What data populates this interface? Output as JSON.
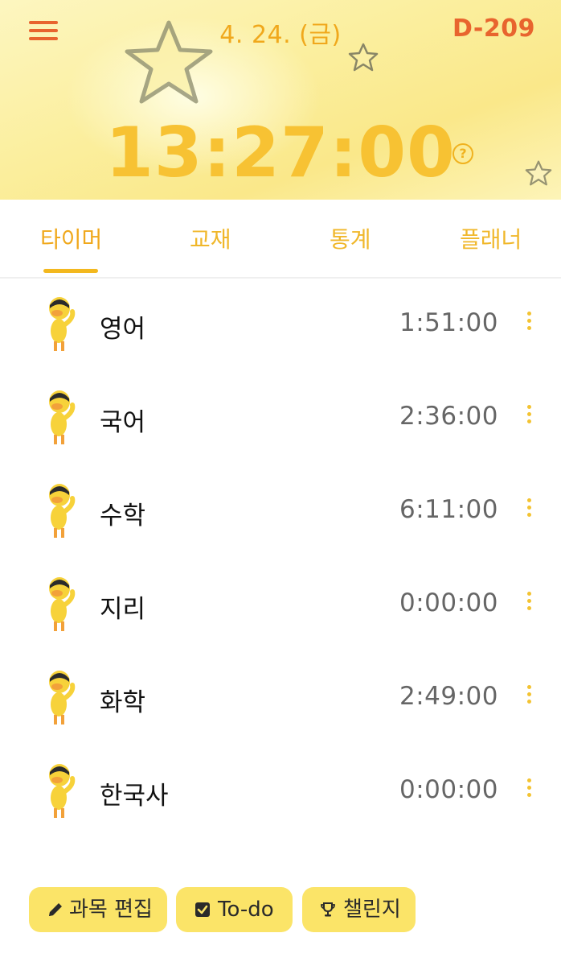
{
  "header": {
    "date": "4. 24. (금)",
    "dday": "D-209",
    "total_time": "13:27:00",
    "help_glyph": "?",
    "accent_color": "#f7c233",
    "dday_color": "#e8642e"
  },
  "tabs": [
    {
      "label": "타이머",
      "selected": true
    },
    {
      "label": "교재",
      "selected": false
    },
    {
      "label": "통계",
      "selected": false
    },
    {
      "label": "플래너",
      "selected": false
    }
  ],
  "subjects": [
    {
      "name": "영어",
      "time": "1:51:00",
      "icon": "duck-avatar-icon"
    },
    {
      "name": "국어",
      "time": "2:36:00",
      "icon": "duck-avatar-icon"
    },
    {
      "name": "수학",
      "time": "6:11:00",
      "icon": "duck-avatar-icon"
    },
    {
      "name": "지리",
      "time": "0:00:00",
      "icon": "duck-avatar-icon"
    },
    {
      "name": "화학",
      "time": "2:49:00",
      "icon": "duck-avatar-icon"
    },
    {
      "name": "한국사",
      "time": "0:00:00",
      "icon": "duck-avatar-icon"
    }
  ],
  "bottom_buttons": [
    {
      "label": "과목 편집",
      "icon": "pencil-icon"
    },
    {
      "label": "To-do",
      "icon": "checkbox-icon"
    },
    {
      "label": "챌린지",
      "icon": "trophy-icon"
    }
  ]
}
